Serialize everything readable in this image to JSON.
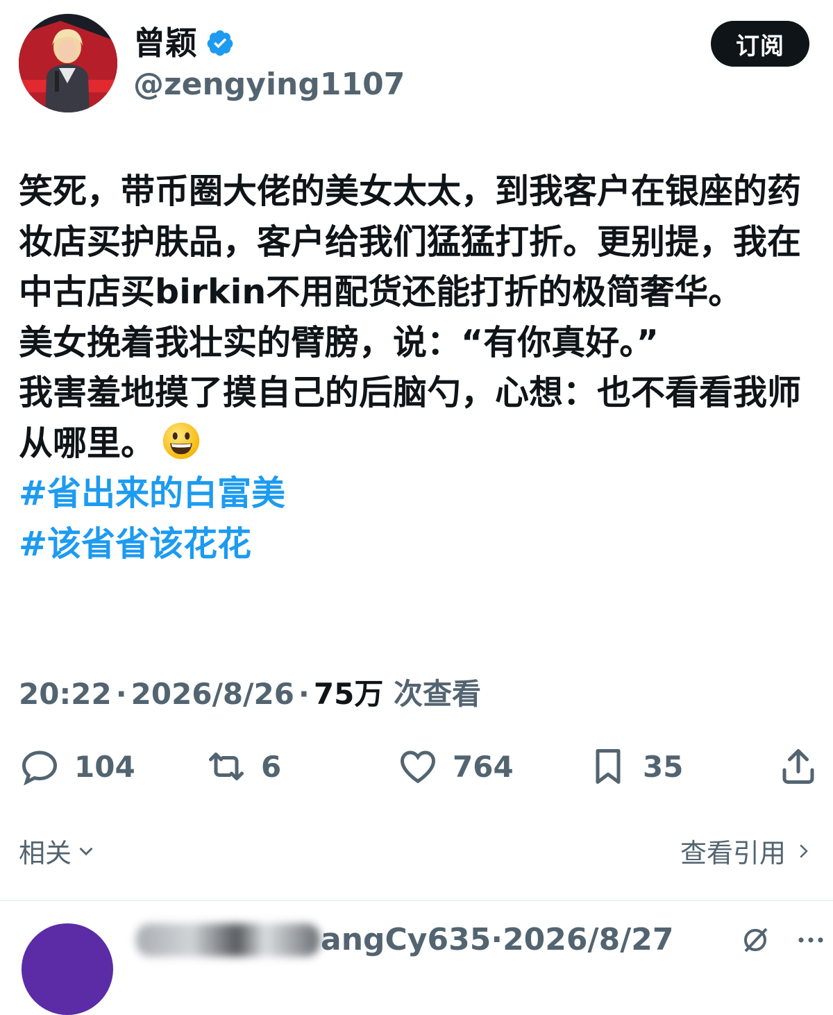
{
  "author": {
    "display_name": "曾颖",
    "handle": "@zengying1107",
    "verified": true,
    "verified_color": "#1d9bf0"
  },
  "subscribe_label": "订阅",
  "post": {
    "paragraphs": [
      "笑死，带币圈大佬的美女太太，到我客户在银座的药妆店买护肤品，客户给我们猛猛打折。更别提，我在中古店买birkin不用配货还能打折的极简奢华。",
      "美女挽着我壮实的臂膀，说：“有你真好。”",
      "我害羞地摸了摸自己的后脑勺，心想：也不看看我师从哪里。"
    ],
    "hashtags": [
      "#省出来的白富美",
      "#该省省该花花"
    ],
    "emoji_icon": "grinning-face-emoji"
  },
  "meta": {
    "time": "20:22",
    "date": "2026/8/26",
    "views": "75万",
    "views_label": "次查看"
  },
  "actions": {
    "replies": "104",
    "reposts": "6",
    "likes": "764",
    "bookmarks": "35"
  },
  "related_label": "相关",
  "view_quotes_label": "查看引用",
  "next_reply": {
    "handle_partial": "angCy635",
    "date": "2026/8/27"
  },
  "colors": {
    "text": "#0f1419",
    "secondary": "#536471",
    "accent": "#1d9bf0",
    "button": "#0f1419"
  }
}
